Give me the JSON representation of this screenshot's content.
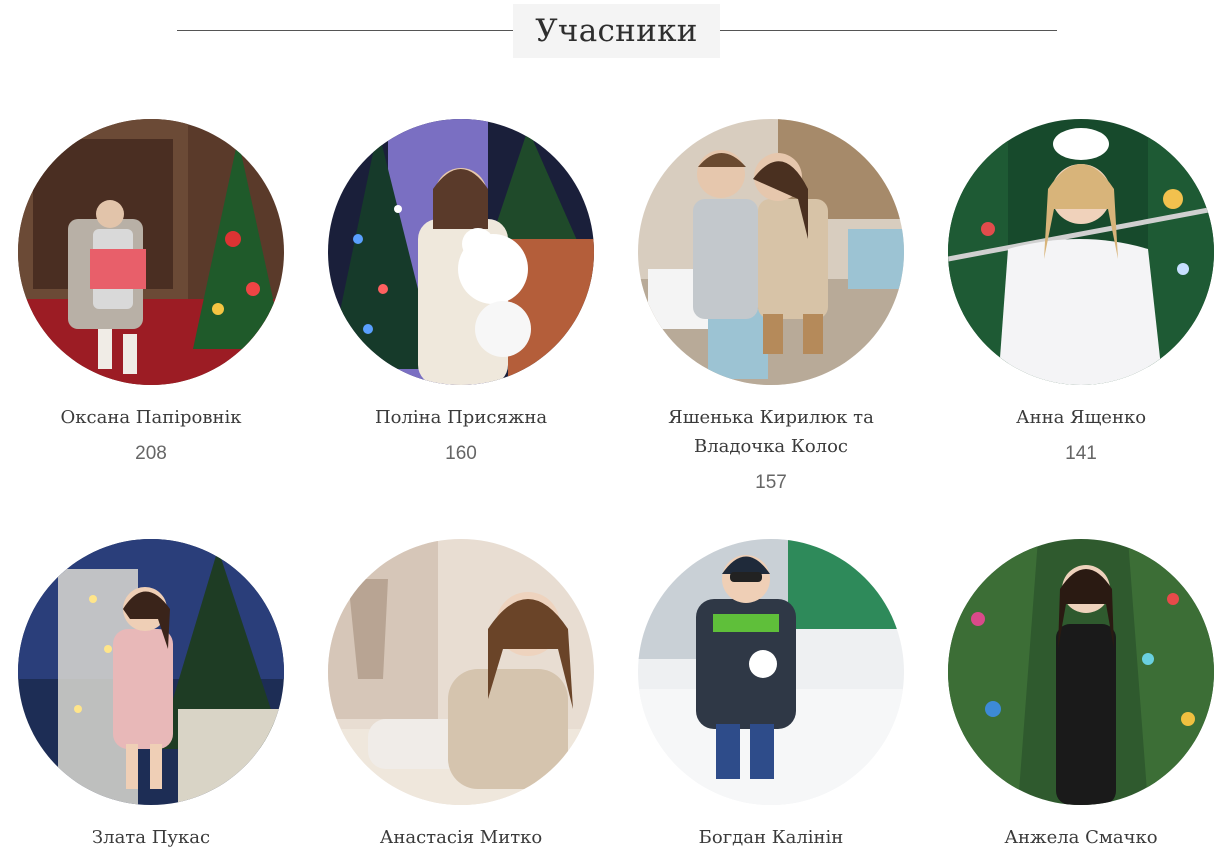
{
  "section": {
    "title": "Учасники"
  },
  "participants": [
    {
      "name": "Оксана Папіровнік",
      "votes": "208"
    },
    {
      "name": "Поліна Присяжна",
      "votes": "160"
    },
    {
      "name": "Яшенька Кирилюк та\nВладочка Колос",
      "votes": "157"
    },
    {
      "name": "Анна Ященко",
      "votes": "141"
    },
    {
      "name": "Злата Пукас",
      "votes": ""
    },
    {
      "name": "Анастасія Митко",
      "votes": ""
    },
    {
      "name": "Богдан Калінін",
      "votes": ""
    },
    {
      "name": "Анжела Смачко",
      "votes": ""
    }
  ]
}
